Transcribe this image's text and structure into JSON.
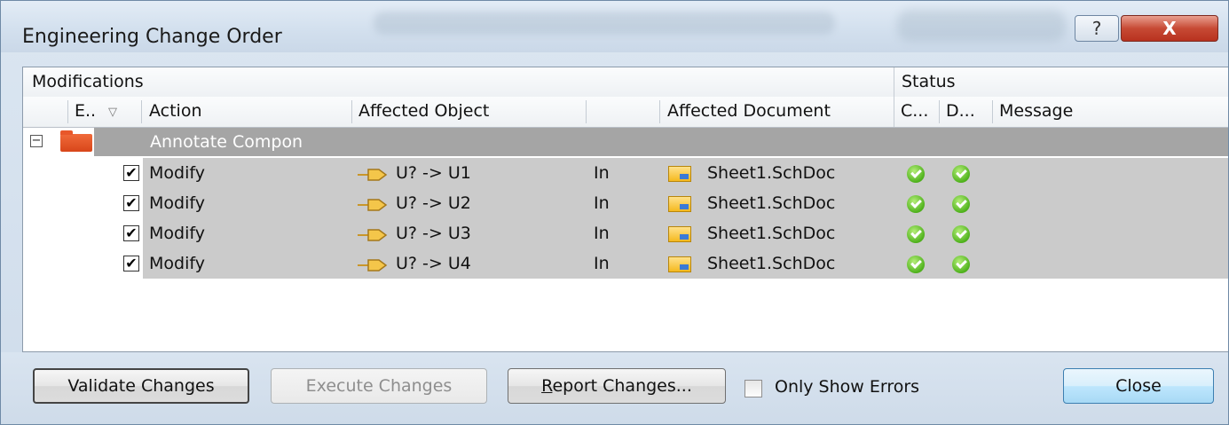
{
  "window": {
    "title": "Engineering Change Order",
    "help_label": "?",
    "close_label": "X"
  },
  "grid": {
    "group_headers": {
      "modifications": "Modifications",
      "status": "Status"
    },
    "columns": {
      "enable": "E..",
      "action": "Action",
      "affected_object": "Affected Object",
      "affected_document": "Affected Document",
      "check": "C...",
      "done": "D...",
      "message": "Message"
    },
    "group": {
      "label": "Annotate Compon",
      "expanded_glyph": "−"
    },
    "rows": [
      {
        "checked": true,
        "action": "Modify",
        "object": "U? -> U1",
        "in": "In",
        "document": "Sheet1.SchDoc",
        "check_status": "ok",
        "done_status": "ok"
      },
      {
        "checked": true,
        "action": "Modify",
        "object": "U? -> U2",
        "in": "In",
        "document": "Sheet1.SchDoc",
        "check_status": "ok",
        "done_status": "ok"
      },
      {
        "checked": true,
        "action": "Modify",
        "object": "U? -> U3",
        "in": "In",
        "document": "Sheet1.SchDoc",
        "check_status": "ok",
        "done_status": "ok"
      },
      {
        "checked": true,
        "action": "Modify",
        "object": "U? -> U4",
        "in": "In",
        "document": "Sheet1.SchDoc",
        "check_status": "ok",
        "done_status": "ok"
      }
    ],
    "check_glyph": "✔"
  },
  "footer": {
    "validate": "Validate Changes",
    "execute": "Execute Changes",
    "report_mnemonic": "R",
    "report_rest": "eport Changes...",
    "only_errors": "Only Show Errors",
    "only_errors_checked": false,
    "close": "Close"
  },
  "colors": {
    "group_bar": "#a5a5a5",
    "row_bar": "#cbcbcb",
    "status_ok": "#4fb21c",
    "folder": "#e8572a",
    "close_button": "#c74a35"
  },
  "icons": {
    "object": "component-pin-icon",
    "document": "schematic-document-icon",
    "status": "green-check-icon",
    "group": "folder-icon"
  }
}
